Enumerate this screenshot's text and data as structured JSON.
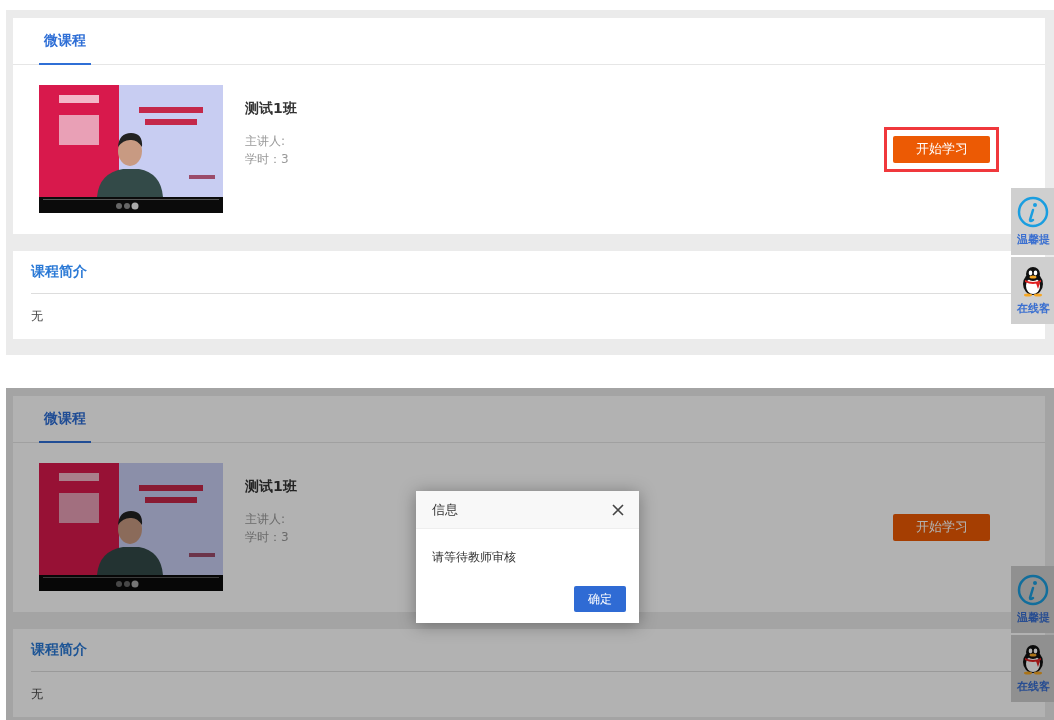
{
  "screens": [
    {
      "tab": {
        "label": "微课程",
        "selected": true
      },
      "course": {
        "title": "测试1班",
        "lecturer": "主讲人:",
        "hours": "学时：3"
      },
      "start_button": {
        "label": "开始学习",
        "callout": {
          "kind": "frame"
        }
      },
      "intro": {
        "title": "课程简介",
        "text": "无"
      },
      "side_tools": [
        {
          "kind": "info",
          "label": "温馨提"
        },
        {
          "kind": "qq",
          "label": "在线客"
        }
      ]
    },
    {
      "tab": {
        "label": "微课程",
        "selected": true
      },
      "course": {
        "title": "测试1班",
        "lecturer": "主讲人:",
        "hours": "学时：3"
      },
      "start_button": {
        "label": "开始学习"
      },
      "intro": {
        "title": "课程简介",
        "text": "无"
      },
      "side_tools": [
        {
          "kind": "info",
          "label": "温馨提"
        },
        {
          "kind": "qq",
          "label": "在线客"
        }
      ],
      "dialog": {
        "title": "信息",
        "message": "请等待教师审核",
        "ok": "确定"
      }
    }
  ]
}
